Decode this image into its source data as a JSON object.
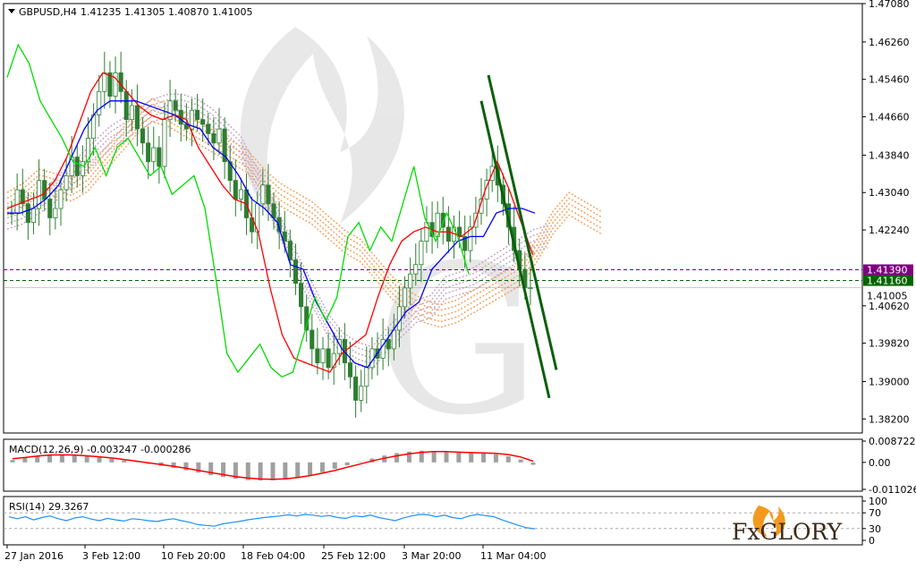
{
  "header": {
    "symbol": "GBPUSD,H4",
    "ohlc": "1.41235 1.41305 1.40870 1.41005"
  },
  "macd": {
    "label": "MACD(12,26,9) -0.003247 -0.000286"
  },
  "rsi": {
    "label": "RSI(14) 29.3267"
  },
  "brand": {
    "text": "FxGLORY"
  },
  "colors": {
    "bull": "#2e7d32",
    "fast_line": "#ff0000",
    "slow_line": "#0000ff",
    "chikou": "#00dd00",
    "cloud_a": "#f4a460",
    "cloud_b": "#c8a8c8",
    "resistance": "#800080",
    "support": "#006400",
    "channel": "#0b5f0b",
    "rsi_line": "#1e90ff",
    "macd_hist": "#a0a0a0",
    "macd_signal": "#ff0000"
  },
  "chart_data": [
    {
      "type": "candlestick",
      "symbol": "GBPUSD",
      "timeframe": "H4",
      "y_ticks": [
        "1.47080",
        "1.46260",
        "1.45460",
        "1.44660",
        "1.43840",
        "1.43040",
        "1.42240",
        "1.40620",
        "1.39820",
        "1.39000",
        "1.38200"
      ],
      "ylim": [
        1.379,
        1.4708
      ],
      "x_ticks": [
        "27 Jan 2016",
        "3 Feb 12:00",
        "10 Feb 20:00",
        "18 Feb 04:00",
        "25 Feb 12:00",
        "3 Mar 20:00",
        "11 Mar 04:00"
      ],
      "price_levels": [
        {
          "value": "1.41390",
          "color": "#800080",
          "style": "dashed"
        },
        {
          "value": "1.41160",
          "color": "#006400",
          "style": "dashed"
        }
      ],
      "current_price": "1.41005",
      "candle_closes": [
        1.426,
        1.431,
        1.428,
        1.424,
        1.427,
        1.433,
        1.429,
        1.425,
        1.427,
        1.431,
        1.434,
        1.438,
        1.434,
        1.437,
        1.442,
        1.447,
        1.452,
        1.456,
        1.451,
        1.456,
        1.452,
        1.446,
        1.449,
        1.444,
        1.441,
        1.437,
        1.44,
        1.436,
        1.446,
        1.45,
        1.448,
        1.445,
        1.444,
        1.448,
        1.446,
        1.445,
        1.443,
        1.441,
        1.444,
        1.437,
        1.433,
        1.429,
        1.431,
        1.425,
        1.422,
        1.428,
        1.432,
        1.428,
        1.425,
        1.422,
        1.42,
        1.416,
        1.411,
        1.406,
        1.401,
        1.397,
        1.394,
        1.397,
        1.393,
        1.396,
        1.399,
        1.394,
        1.391,
        1.386,
        1.389,
        1.393,
        1.397,
        1.395,
        1.399,
        1.397,
        1.401,
        1.406,
        1.41,
        1.413,
        1.415,
        1.42,
        1.424,
        1.421,
        1.426,
        1.423,
        1.42,
        1.423,
        1.421,
        1.418,
        1.423,
        1.426,
        1.429,
        1.433,
        1.436,
        1.432,
        1.428,
        1.423,
        1.418,
        1.414,
        1.41,
        1.41005
      ],
      "lines": [
        {
          "name": "red",
          "values": [
            1.427,
            1.428,
            1.429,
            1.43,
            1.433,
            1.438,
            1.445,
            1.452,
            1.456,
            1.455,
            1.452,
            1.449,
            1.447,
            1.446,
            1.447,
            1.446,
            1.44,
            1.436,
            1.432,
            1.429,
            1.428,
            1.422,
            1.41,
            1.4,
            1.395,
            1.394,
            1.393,
            1.392,
            1.396,
            1.398,
            1.4,
            1.408,
            1.415,
            1.42,
            1.422,
            1.423,
            1.422,
            1.422,
            1.421,
            1.423,
            1.431,
            1.437,
            1.431,
            1.424,
            1.417
          ]
        },
        {
          "name": "blue",
          "values": [
            1.426,
            1.426,
            1.427,
            1.429,
            1.432,
            1.438,
            1.444,
            1.448,
            1.45,
            1.45,
            1.45,
            1.449,
            1.448,
            1.447,
            1.445,
            1.444,
            1.44,
            1.438,
            1.434,
            1.429,
            1.427,
            1.424,
            1.415,
            1.414,
            1.407,
            1.402,
            1.397,
            1.394,
            1.393,
            1.397,
            1.401,
            1.405,
            1.407,
            1.414,
            1.417,
            1.42,
            1.421,
            1.421,
            1.426,
            1.427,
            1.427,
            1.426
          ]
        },
        {
          "name": "green",
          "values": [
            1.455,
            1.462,
            1.458,
            1.45,
            1.446,
            1.442,
            1.437,
            1.436,
            1.44,
            1.434,
            1.44,
            1.442,
            1.438,
            1.434,
            1.436,
            1.43,
            1.432,
            1.434,
            1.427,
            1.412,
            1.396,
            1.392,
            1.395,
            1.398,
            1.393,
            1.391,
            1.392,
            1.4,
            1.408,
            1.403,
            1.408,
            1.421,
            1.424,
            1.418,
            1.423,
            1.42,
            1.428,
            1.436,
            1.425,
            1.42,
            1.426,
            1.421,
            1.413
          ]
        },
        {
          "name": "cloud_orange",
          "values": [
            1.428,
            1.43,
            1.433,
            1.432,
            1.431,
            1.433,
            1.437,
            1.441,
            1.445,
            1.448,
            1.447,
            1.445,
            1.443,
            1.441,
            1.439,
            1.437,
            1.433,
            1.43,
            1.428,
            1.426,
            1.423,
            1.42,
            1.418,
            1.414,
            1.41,
            1.407,
            1.405,
            1.404,
            1.405,
            1.407,
            1.409,
            1.411,
            1.413,
            1.418,
            1.424,
            1.428,
            1.426,
            1.424
          ]
        },
        {
          "name": "cloud_purple",
          "values": [
            1.425,
            1.426,
            1.428,
            1.43,
            1.433,
            1.436,
            1.439,
            1.442,
            1.444,
            1.446,
            1.448,
            1.449,
            1.449,
            1.448,
            1.446,
            1.443,
            1.44,
            1.434,
            1.428,
            1.421,
            1.414,
            1.408,
            1.402,
            1.398,
            1.396,
            1.395,
            1.399,
            1.402,
            1.405,
            1.406,
            1.41,
            1.411,
            1.412,
            1.414,
            1.416,
            1.418,
            1.42,
            1.421
          ]
        }
      ],
      "channel_lines": [
        {
          "name": "upper",
          "from": 1.4555,
          "to": 1.3925
        },
        {
          "name": "lower",
          "from": 1.45,
          "to": 1.3865
        }
      ]
    },
    {
      "type": "histogram_line",
      "name": "MACD(12,26,9)",
      "y_ticks": [
        "0.008722",
        "0.00",
        "-0.011026"
      ],
      "ylim": [
        -0.011026,
        0.008722
      ],
      "histogram": [
        0.001,
        0.0018,
        0.0026,
        0.003,
        0.0031,
        0.0029,
        0.0025,
        0.002,
        0.0015,
        0.0008,
        0.0001,
        -0.0006,
        -0.0014,
        -0.0022,
        -0.0032,
        -0.0042,
        -0.0052,
        -0.006,
        -0.0067,
        -0.0072,
        -0.0074,
        -0.0073,
        -0.007,
        -0.0063,
        -0.0052,
        -0.004,
        -0.0026,
        -0.0012,
        0.0002,
        0.0016,
        0.0028,
        0.0038,
        0.0044,
        0.0048,
        0.0047,
        0.0044,
        0.004,
        0.0038,
        0.0037,
        0.0033,
        0.0025,
        0.0012,
        -0.001
      ],
      "signal": [
        0.0015,
        0.002,
        0.0026,
        0.003,
        0.0031,
        0.003,
        0.0027,
        0.0023,
        0.0018,
        0.0012,
        0.0005,
        -0.0002,
        -0.0009,
        -0.0016,
        -0.0024,
        -0.0033,
        -0.0042,
        -0.005,
        -0.0058,
        -0.0064,
        -0.0068,
        -0.0069,
        -0.0067,
        -0.0062,
        -0.0054,
        -0.0044,
        -0.0033,
        -0.002,
        -0.0007,
        0.0006,
        0.0017,
        0.0027,
        0.0035,
        0.0041,
        0.0044,
        0.0044,
        0.0042,
        0.004,
        0.0039,
        0.0037,
        0.0032,
        0.0022,
        0.0005
      ]
    },
    {
      "type": "line",
      "name": "RSI(14)",
      "y_ticks": [
        "100",
        "70",
        "30",
        "0"
      ],
      "ylim": [
        0,
        100
      ],
      "levels": [
        70,
        30
      ],
      "values": [
        60,
        55,
        60,
        52,
        58,
        62,
        55,
        50,
        57,
        60,
        54,
        50,
        56,
        52,
        49,
        55,
        53,
        50,
        48,
        52,
        55,
        50,
        46,
        40,
        38,
        36,
        42,
        45,
        48,
        52,
        55,
        58,
        60,
        62,
        65,
        62,
        66,
        64,
        61,
        63,
        58,
        56,
        62,
        60,
        64,
        58,
        54,
        50,
        57,
        62,
        66,
        65,
        60,
        64,
        58,
        55,
        62,
        66,
        63,
        60,
        52,
        45,
        38,
        32,
        29.3267
      ]
    }
  ]
}
